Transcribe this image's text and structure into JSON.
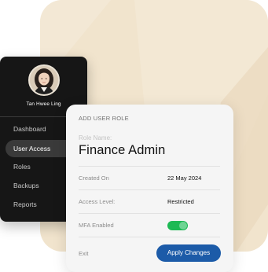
{
  "profile": {
    "name": "Tan Hwee Ling"
  },
  "sidebar": {
    "items": [
      {
        "label": "Dashboard"
      },
      {
        "label": "User Access"
      },
      {
        "label": "Roles"
      },
      {
        "label": "Backups"
      },
      {
        "label": "Reports"
      }
    ],
    "active": "User Access"
  },
  "card": {
    "title": "ADD USER ROLE",
    "role_label": "Role Name:",
    "role_value": "Finance Admin",
    "rows": [
      {
        "key": "Created On",
        "value": "22 May 2024"
      },
      {
        "key": "Access Level:",
        "value": "Restricted"
      },
      {
        "key": "MFA Enabled",
        "value": ""
      }
    ],
    "mfa_enabled": true,
    "exit_label": "Exit",
    "apply_label": "Apply Changes"
  },
  "colors": {
    "backdrop": "#f1e4cd",
    "sidebar_bg": "#161616",
    "accent_button": "#1c5ba8",
    "toggle_on": "#1db954"
  },
  "icons": {
    "avatar": "user-avatar-photo"
  }
}
